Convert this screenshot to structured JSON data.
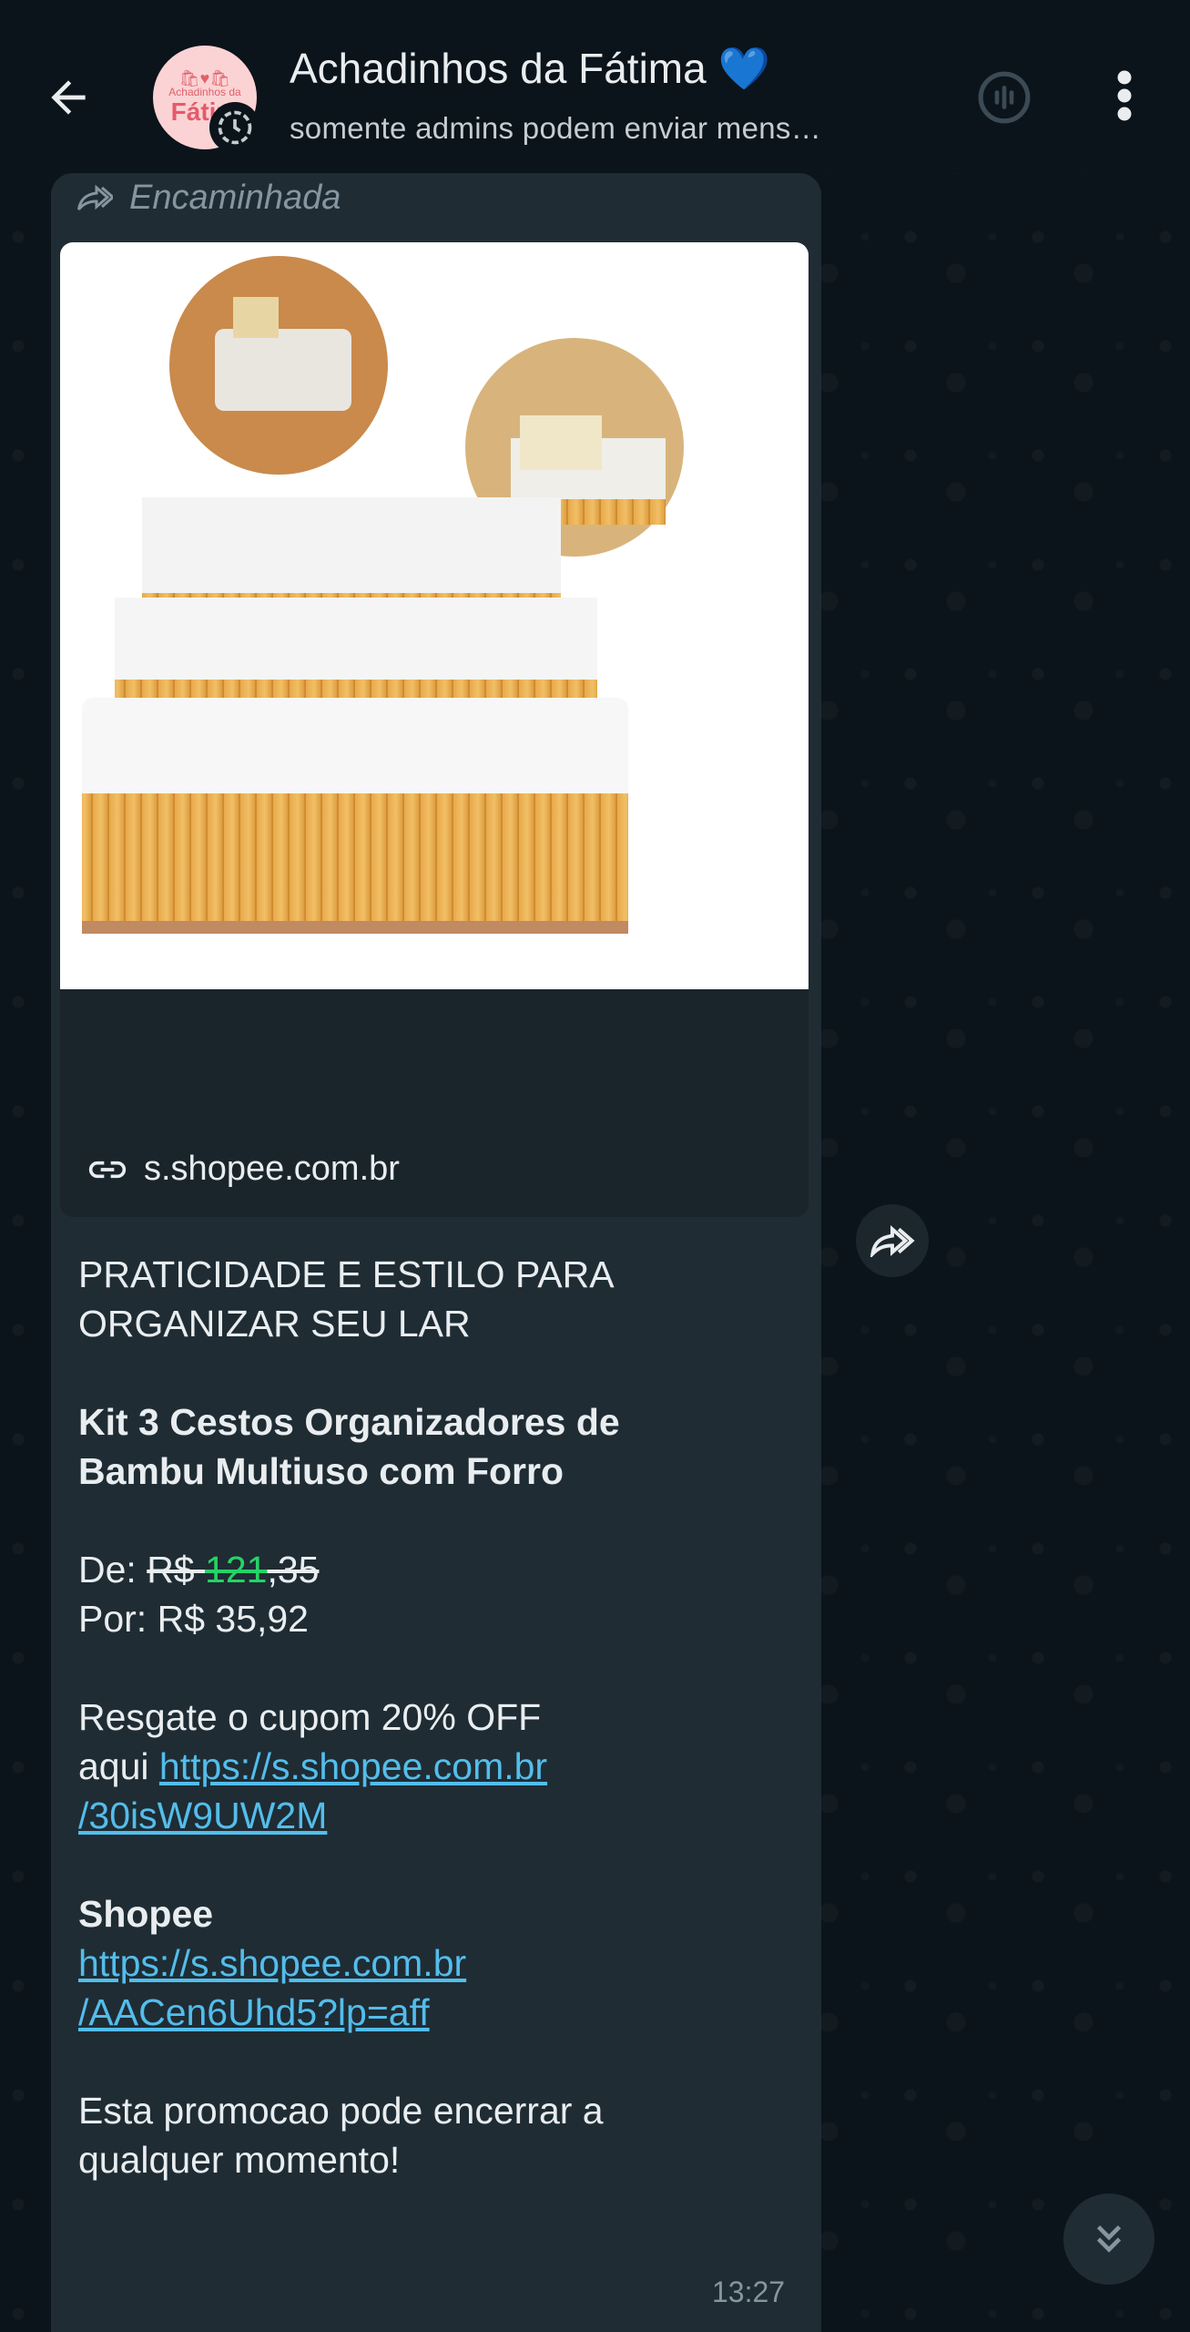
{
  "header": {
    "title": "Achadinhos da Fátima 💙",
    "subtitle": "somente admins podem enviar mens…",
    "avatar": {
      "small_text": "Achadinhos da",
      "name_text": "Fátim"
    },
    "icons": {
      "back": "arrow-left-icon",
      "community": "community-badge-icon",
      "call": "voice-chat-icon",
      "more": "more-vertical-icon"
    }
  },
  "message": {
    "forwarded_label": "Encaminhada",
    "link_preview": {
      "host": "s.shopee.com.br",
      "image_alt": "Kit 3 cestos de bambu com forro"
    },
    "headline_line1": "PRATICIDADE E ESTILO PARA",
    "headline_line2": "ORGANIZAR SEU LAR",
    "product_line1": "Kit 3 Cestos Organizadores de",
    "product_line2": "Bambu Multiuso com Forro",
    "price_from_label": "De: ",
    "price_from_currency": "R$ ",
    "price_from_int": "121",
    "price_from_dec": ",35",
    "price_to": "Por: R$ 35,92",
    "coupon_line1": "Resgate o cupom 20% OFF",
    "coupon_prefix": "aqui ",
    "coupon_link_part1": "https://s.shopee.com.br",
    "coupon_link_part2": "/30isW9UW2M",
    "store_label": "Shopee",
    "store_link_part1": "https://s.shopee.com.br",
    "store_link_part2": "/AACen6Uhd5?lp=aff",
    "footer_line1": "Esta promocao pode encerrar a",
    "footer_line2": "qualquer momento!",
    "time": "13:27"
  },
  "colors": {
    "background": "#0b141a",
    "bubble": "#1f2c34",
    "link": "#53bdeb",
    "accent_green": "#25d366",
    "muted": "#8696a0"
  }
}
